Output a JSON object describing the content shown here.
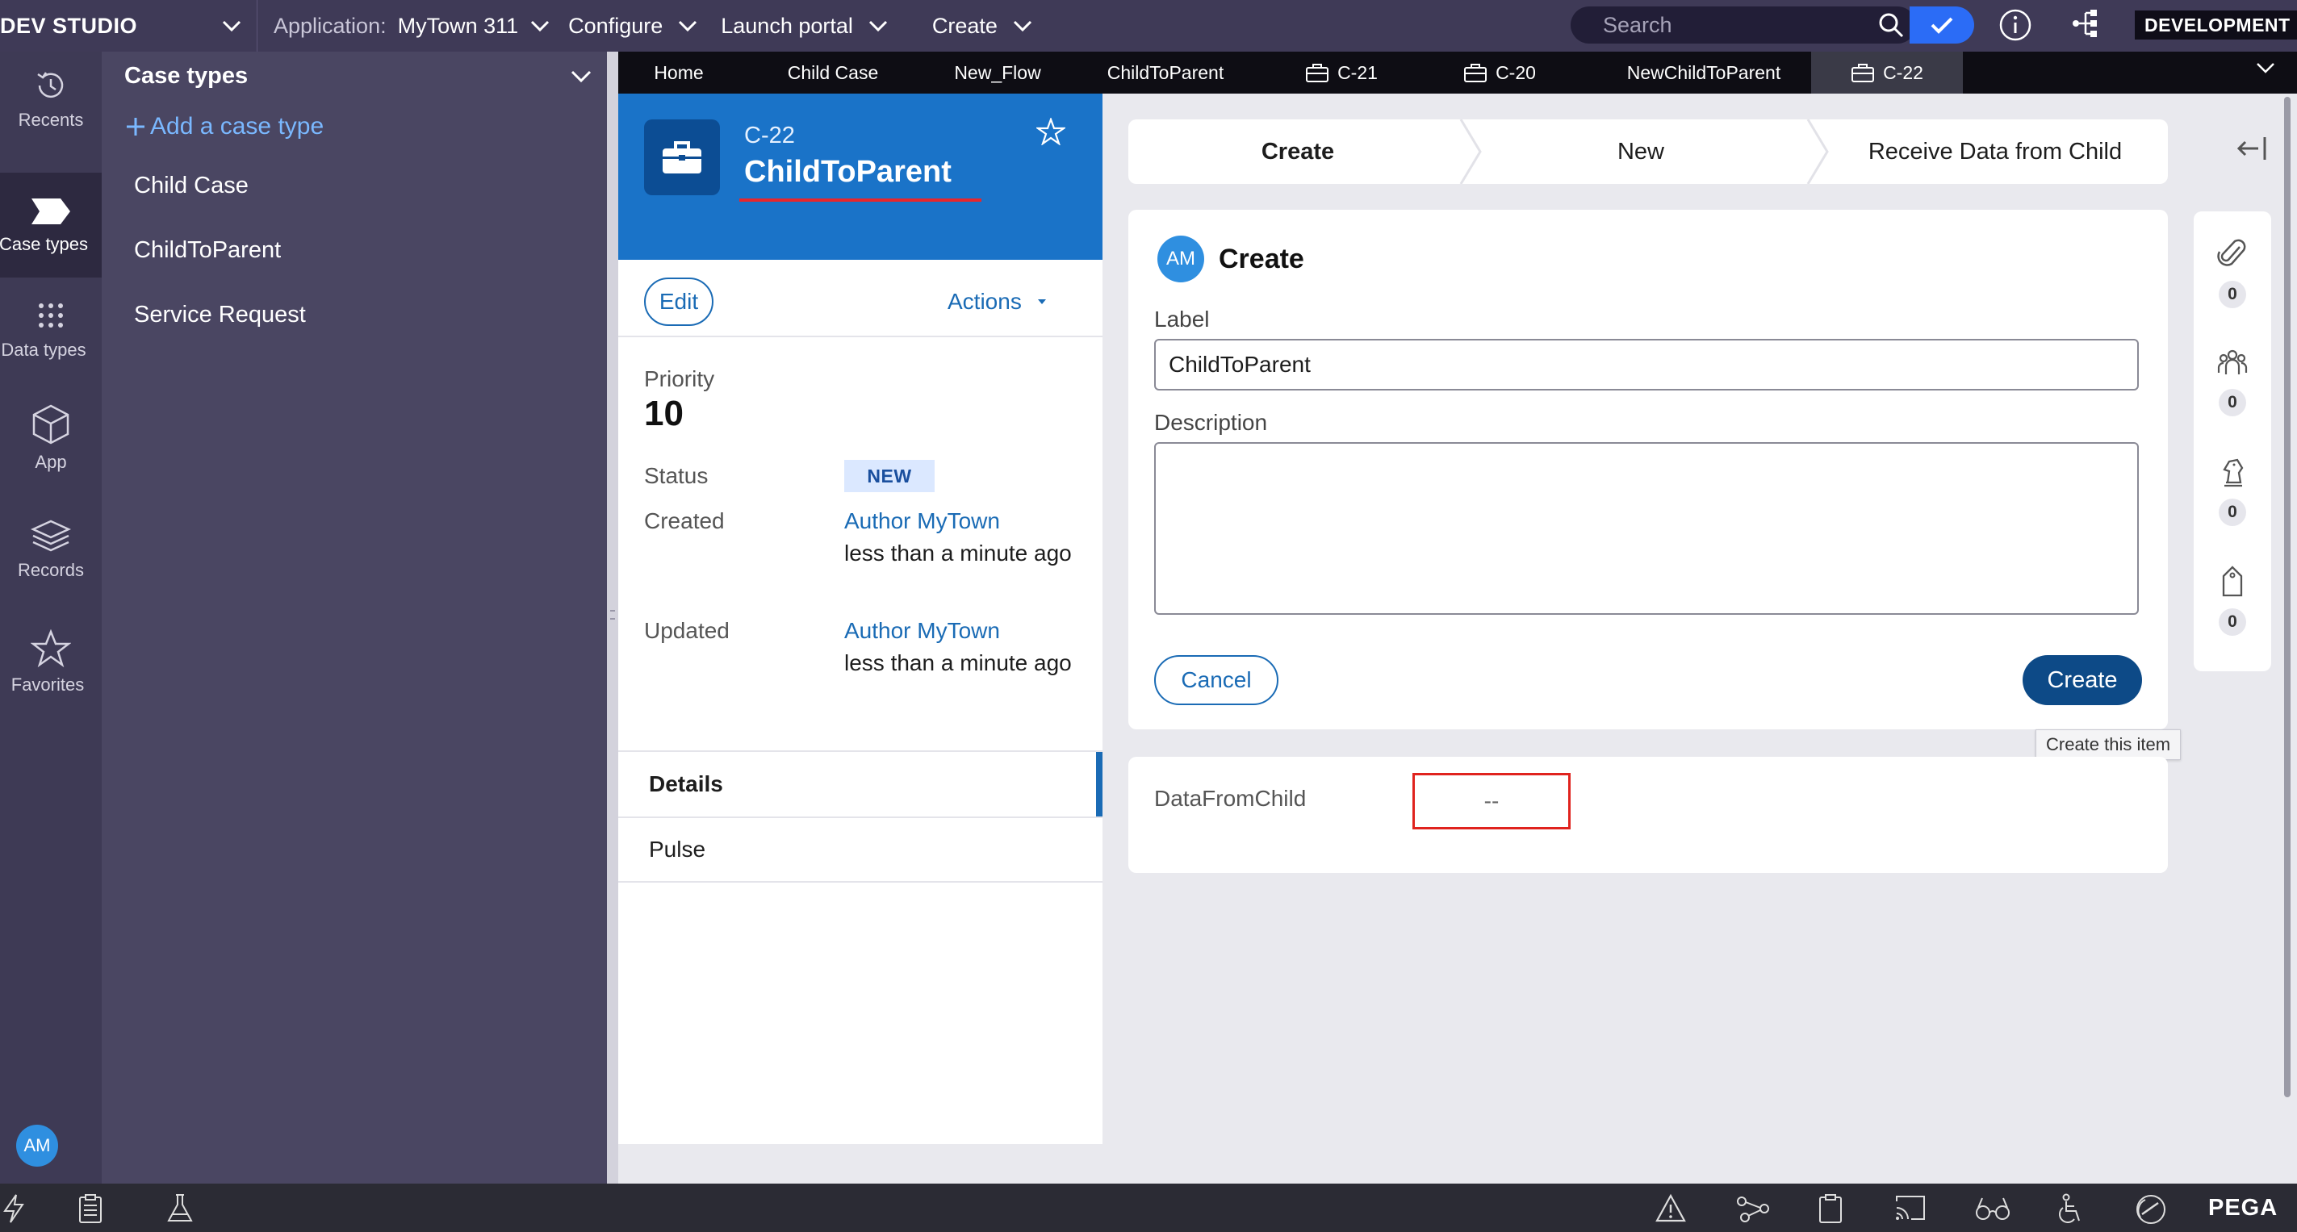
{
  "topbar": {
    "brand": "DEV STUDIO",
    "application_label": "Application:",
    "application_name": "MyTown 311",
    "menu": [
      "Configure",
      "Launch portal",
      "Create"
    ],
    "search_placeholder": "Search",
    "environment": "DEVELOPMENT"
  },
  "rail": {
    "items": [
      {
        "label": "Recents",
        "icon": "history-icon"
      },
      {
        "label": "Case types",
        "icon": "case-types-icon"
      },
      {
        "label": "Data types",
        "icon": "data-types-icon"
      },
      {
        "label": "App",
        "icon": "app-cube-icon"
      },
      {
        "label": "Records",
        "icon": "records-layers-icon"
      },
      {
        "label": "Favorites",
        "icon": "star-icon"
      }
    ],
    "avatar": "AM"
  },
  "explorer": {
    "title": "Case types",
    "add_link": "Add a case type",
    "items": [
      "Child Case",
      "ChildToParent",
      "Service Request"
    ]
  },
  "tabs": [
    {
      "label": "Home",
      "icon": ""
    },
    {
      "label": "Child Case",
      "icon": ""
    },
    {
      "label": "New_Flow",
      "icon": ""
    },
    {
      "label": "ChildToParent",
      "icon": ""
    },
    {
      "label": "C-21",
      "icon": "briefcase-icon"
    },
    {
      "label": "C-20",
      "icon": "briefcase-icon"
    },
    {
      "label": "NewChildToParent",
      "icon": ""
    },
    {
      "label": "C-22",
      "icon": "briefcase-icon",
      "active": true
    }
  ],
  "case": {
    "id": "C-22",
    "title": "ChildToParent",
    "edit_label": "Edit",
    "actions_label": "Actions",
    "priority_label": "Priority",
    "priority_value": "10",
    "status_label": "Status",
    "status_value": "NEW",
    "created_label": "Created",
    "created_by": "Author MyTown",
    "created_when": "less than a minute ago",
    "updated_label": "Updated",
    "updated_by": "Author MyTown",
    "updated_when": "less than a minute ago",
    "nav": [
      "Details",
      "Pulse"
    ]
  },
  "stages": [
    "Create",
    "New",
    "Receive Data from Child"
  ],
  "form": {
    "avatar": "AM",
    "title": "Create",
    "label_field_label": "Label",
    "label_field_value": "ChildToParent",
    "description_label": "Description",
    "description_value": "",
    "cancel_label": "Cancel",
    "create_label": "Create",
    "create_tooltip": "Create this item"
  },
  "data_panel": {
    "label": "DataFromChild",
    "value": "--"
  },
  "utility": [
    {
      "icon": "paperclip-icon",
      "count": "0"
    },
    {
      "icon": "people-icon",
      "count": "0"
    },
    {
      "icon": "chess-knight-icon",
      "count": "0"
    },
    {
      "icon": "tag-icon",
      "count": "0"
    }
  ],
  "bottom": {
    "brand": "PEGA"
  },
  "colors": {
    "topbar": "#3f3a57",
    "accent_blue": "#1a6bb5",
    "case_header": "#1a73c8",
    "primary_button": "#0d4a87",
    "highlight_red": "#e0231e"
  }
}
